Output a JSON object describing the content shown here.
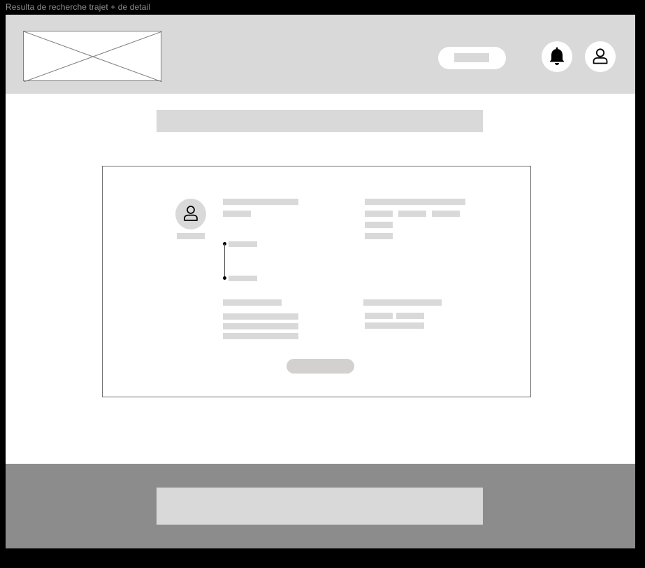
{
  "frame": {
    "title": "Resulta de recherche trajet + de detail"
  },
  "header": {
    "logo_icon": "image-placeholder-icon",
    "notification_icon": "bell-icon",
    "profile_icon": "user-icon"
  },
  "card": {
    "driver_avatar_icon": "user-icon"
  },
  "colors": {
    "header_bg": "#d9d9d9",
    "footer_bg": "#8c8c8c",
    "placeholder": "#d9d9d9",
    "button_bg": "#d3d0d0"
  }
}
